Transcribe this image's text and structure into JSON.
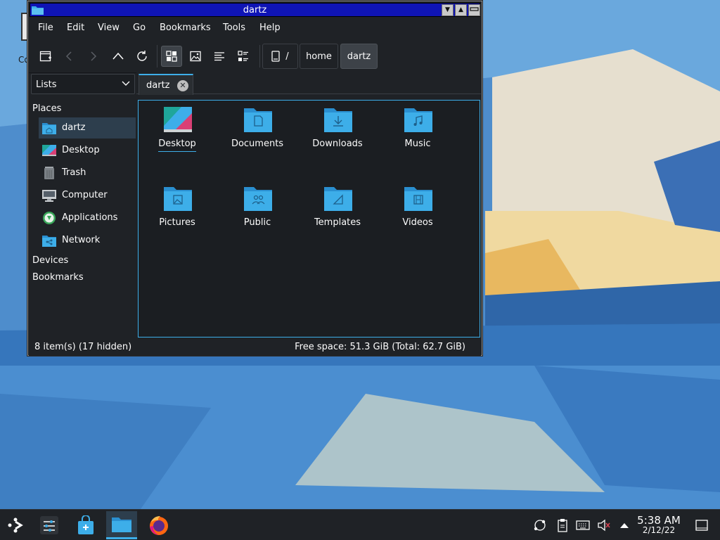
{
  "window": {
    "title": "dartz",
    "menus": [
      "File",
      "Edit",
      "View",
      "Go",
      "Bookmarks",
      "Tools",
      "Help"
    ],
    "breadcrumb": {
      "root": "/",
      "parts": [
        "home",
        "dartz"
      ]
    },
    "panel_selector": "Lists",
    "tab": {
      "label": "dartz"
    },
    "places": {
      "heading": "Places",
      "items": [
        {
          "label": "dartz",
          "icon": "home-folder-icon"
        },
        {
          "label": "Desktop",
          "icon": "desktop-icon"
        },
        {
          "label": "Trash",
          "icon": "trash-icon"
        },
        {
          "label": "Computer",
          "icon": "computer-icon"
        },
        {
          "label": "Applications",
          "icon": "applications-icon"
        },
        {
          "label": "Network",
          "icon": "network-folder-icon"
        }
      ],
      "devices_heading": "Devices",
      "bookmarks_heading": "Bookmarks"
    },
    "files": [
      {
        "label": "Desktop",
        "icon": "desktop-icon"
      },
      {
        "label": "Documents",
        "icon": "documents-folder-icon"
      },
      {
        "label": "Downloads",
        "icon": "downloads-folder-icon"
      },
      {
        "label": "Music",
        "icon": "music-folder-icon"
      },
      {
        "label": "Pictures",
        "icon": "pictures-folder-icon"
      },
      {
        "label": "Public",
        "icon": "public-folder-icon"
      },
      {
        "label": "Templates",
        "icon": "templates-folder-icon"
      },
      {
        "label": "Videos",
        "icon": "videos-folder-icon"
      }
    ],
    "status": {
      "items": "8 item(s) (17 hidden)",
      "free_space": "Free space: 51.3 GiB (Total: 62.7 GiB)"
    }
  },
  "desktop": {
    "partial_icon_label": "Co"
  },
  "taskbar": {
    "time": "5:38 AM",
    "date": "2/12/22"
  },
  "colors": {
    "accent": "#3daee9",
    "titlebar": "#0f14b5",
    "window_bg": "#1f2226",
    "folder": "#3daee9"
  }
}
